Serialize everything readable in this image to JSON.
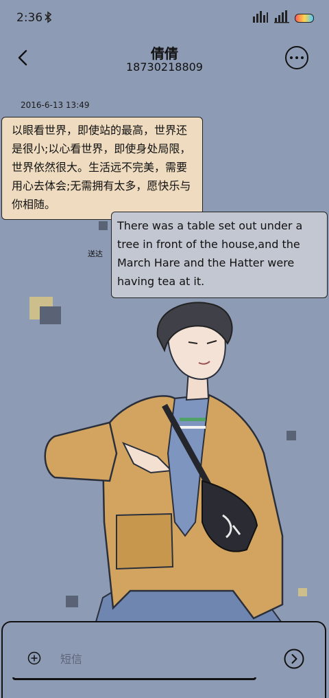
{
  "status_bar": {
    "time": "2:36",
    "bluetooth_icon": "bluetooth-icon",
    "signal_icon": "signal-icon",
    "battery_icon": "battery-icon"
  },
  "header": {
    "contact_name": "倩倩",
    "contact_number": "18730218809"
  },
  "conversation": {
    "timestamp": "2016-6-13 13:49",
    "incoming_message": "以眼看世界，即使站的最高，世界还是很小;以心看世界，即使身处局限，世界依然很大。生活远不完美，需要用心去体会;无需拥有太多，愿快乐与你相随。",
    "outgoing_message": "There was a table set out under a tree in front of the house,and the March Hare and the Hatter were having tea at it.",
    "outgoing_status": "送达"
  },
  "compose": {
    "placeholder": "短信"
  },
  "colors": {
    "background": "#8e9bb4",
    "incoming_bubble": "#efdcc0",
    "outgoing_bubble": "#c3c7d2",
    "accent_yellow": "#d8c68a"
  }
}
